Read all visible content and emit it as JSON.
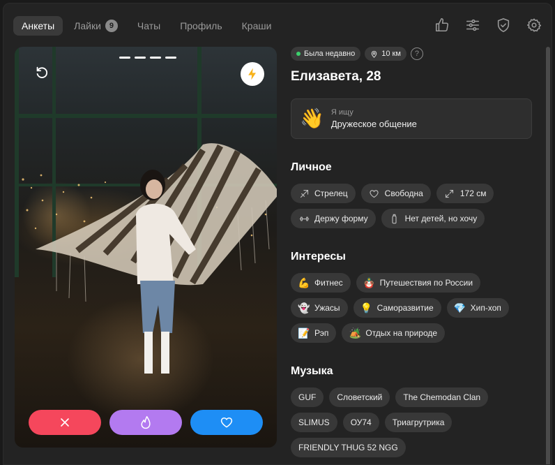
{
  "nav": {
    "tabs": [
      {
        "label": "Анкеты",
        "active": true
      },
      {
        "label": "Лайки",
        "badge": "9"
      },
      {
        "label": "Чаты"
      },
      {
        "label": "Профиль"
      },
      {
        "label": "Краши"
      }
    ],
    "icons": [
      "thumbs-up-icon",
      "sliders-icon",
      "shield-check-icon",
      "gear-icon"
    ]
  },
  "profile": {
    "status": "Была недавно",
    "distance": "10 км",
    "help": "?",
    "name": "Елизавета, 28",
    "looking_for_label": "Я ищу",
    "looking_for_value": "Дружеское общение",
    "looking_for_emoji": "👋"
  },
  "sections": {
    "personal": {
      "title": "Личное",
      "chips": [
        {
          "label": "Стрелец",
          "icon": "arrow-diagonal-icon"
        },
        {
          "label": "Свободна",
          "icon": "heart-outline-icon"
        },
        {
          "label": "172 см",
          "icon": "expand-icon"
        },
        {
          "label": "Держу форму",
          "icon": "dumbbell-icon"
        },
        {
          "label": "Нет детей, но хочу",
          "icon": "baby-bottle-icon"
        }
      ]
    },
    "interests": {
      "title": "Интересы",
      "chips": [
        {
          "label": "Фитнес",
          "emoji": "💪"
        },
        {
          "label": "Путешествия по России",
          "emoji": "🪆"
        },
        {
          "label": "Ужасы",
          "emoji": "👻"
        },
        {
          "label": "Саморазвитие",
          "emoji": "💡"
        },
        {
          "label": "Хип-хоп",
          "emoji": "💎"
        },
        {
          "label": "Рэп",
          "emoji": "📝"
        },
        {
          "label": "Отдых на природе",
          "emoji": "🏕️"
        }
      ]
    },
    "music": {
      "title": "Музыка",
      "chips": [
        {
          "label": "GUF"
        },
        {
          "label": "Словетский"
        },
        {
          "label": "The Chemodan Clan"
        },
        {
          "label": "SLIMUS"
        },
        {
          "label": "ОУ74"
        },
        {
          "label": "Триагрутрика"
        },
        {
          "label": "FRIENDLY THUG 52 NGG"
        }
      ]
    }
  },
  "colors": {
    "dislike": "#f5475c",
    "super": "#b37af0",
    "like": "#1e8ef5",
    "online": "#3ccf6c"
  }
}
